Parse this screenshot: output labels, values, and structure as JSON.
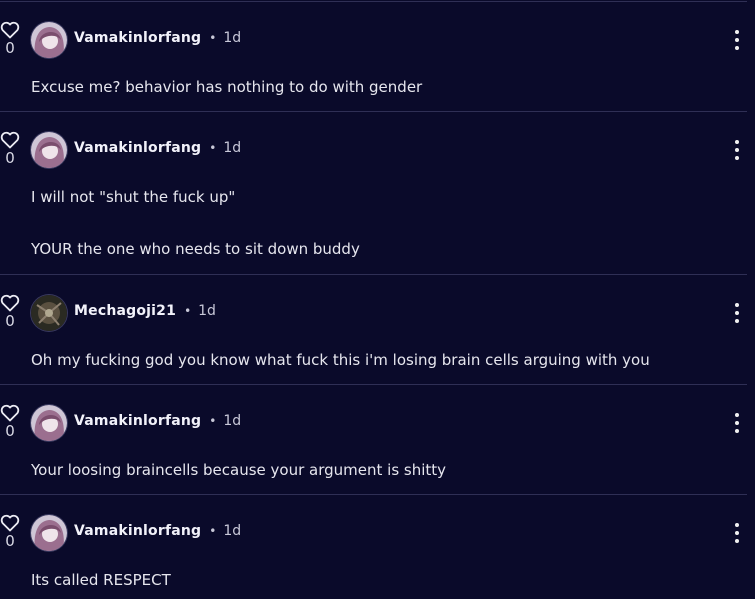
{
  "colors": {
    "background": "#0a0a2a",
    "divider": "#2f2f55",
    "text": "#e6e6ee"
  },
  "comments": [
    {
      "user": "Vamakinlorfang",
      "time": "1d",
      "likes": "0",
      "avatar": "pink-hair-avatar",
      "lines": [
        "Excuse me? behavior has nothing to do with gender"
      ]
    },
    {
      "user": "Vamakinlorfang",
      "time": "1d",
      "likes": "0",
      "avatar": "pink-hair-avatar",
      "lines": [
        "I will not \"shut the fuck up\"",
        "YOUR the one who needs to sit down buddy"
      ]
    },
    {
      "user": "Mechagoji21",
      "time": "1d",
      "likes": "0",
      "avatar": "dark-robot-avatar",
      "lines": [
        "Oh my fucking god you know what fuck this i'm losing brain cells arguing with you"
      ]
    },
    {
      "user": "Vamakinlorfang",
      "time": "1d",
      "likes": "0",
      "avatar": "pink-hair-avatar",
      "lines": [
        "Your loosing braincells because your argument is shitty"
      ]
    },
    {
      "user": "Vamakinlorfang",
      "time": "1d",
      "likes": "0",
      "avatar": "pink-hair-avatar",
      "lines": [
        "Its called RESPECT"
      ]
    }
  ]
}
